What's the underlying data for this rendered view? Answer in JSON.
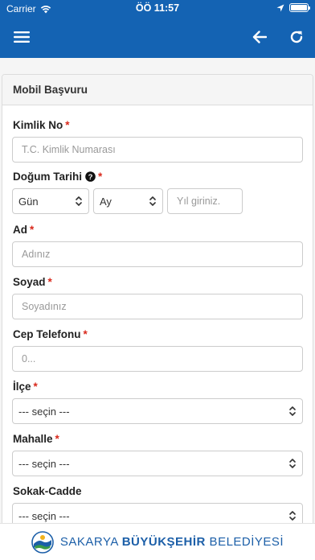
{
  "status_bar": {
    "carrier": "Carrier",
    "time": "ÖÖ 11:57"
  },
  "nav": {
    "menu_icon": "hamburger-icon",
    "back_icon": "arrow-left-icon",
    "refresh_icon": "refresh-icon"
  },
  "panel": {
    "title": "Mobil Başvuru"
  },
  "form": {
    "kimlik": {
      "label": "Kimlik No",
      "required": "*",
      "placeholder": "T.C. Kimlik Numarası"
    },
    "dogum": {
      "label": "Doğum Tarihi",
      "required": "*",
      "day": "Gün",
      "month": "Ay",
      "year_placeholder": "Yıl giriniz."
    },
    "ad": {
      "label": "Ad",
      "required": "*",
      "placeholder": "Adınız"
    },
    "soyad": {
      "label": "Soyad",
      "required": "*",
      "placeholder": "Soyadınız"
    },
    "telefon": {
      "label": "Cep Telefonu",
      "required": "*",
      "placeholder": "0..."
    },
    "ilce": {
      "label": "İlçe",
      "required": "*",
      "value": "--- seçin ---"
    },
    "mahalle": {
      "label": "Mahalle",
      "required": "*",
      "value": "--- seçin ---"
    },
    "sokak": {
      "label": "Sokak-Cadde",
      "value": "--- seçin ---"
    }
  },
  "footer": {
    "text_1": "SAKARYA ",
    "text_2": "BÜYÜKŞEHİR",
    "text_3": " BELEDİYESİ"
  },
  "colors": {
    "primary": "#1463b3",
    "required": "#d9291c",
    "footer_text": "#1c5fa8"
  }
}
